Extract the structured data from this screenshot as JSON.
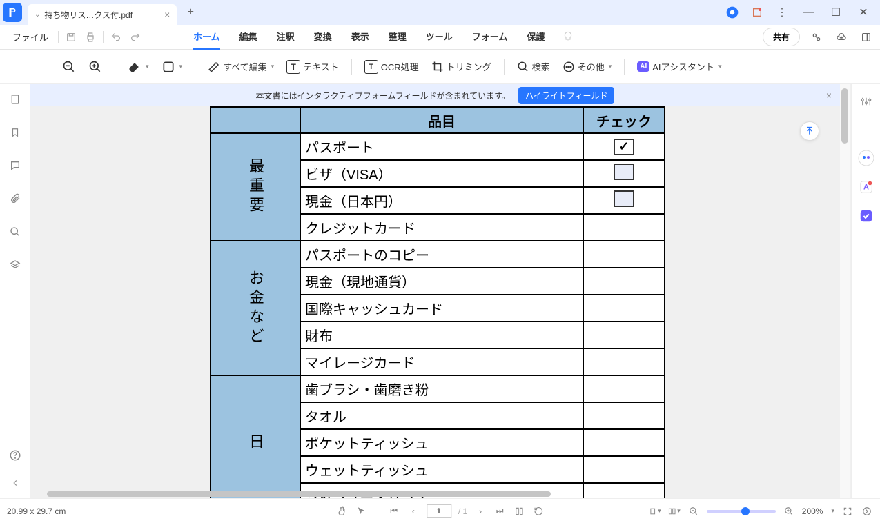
{
  "titlebar": {
    "tab_title": "持ち物リス…クス付.pdf"
  },
  "menubar": {
    "file": "ファイル",
    "tabs": [
      "ホーム",
      "編集",
      "注釈",
      "変換",
      "表示",
      "整理",
      "ツール",
      "フォーム",
      "保護"
    ],
    "share": "共有"
  },
  "toolbar": {
    "edit_all": "すべて編集",
    "text": "テキスト",
    "ocr": "OCR処理",
    "trimming": "トリミング",
    "search": "検索",
    "other": "その他",
    "ai_badge": "AI",
    "ai_assistant": "AIアシスタント"
  },
  "banner": {
    "text": "本文書にはインタラクティブフォームフィールドが含まれています。",
    "button": "ハイライトフィールド"
  },
  "table": {
    "header_item": "品目",
    "header_check": "チェック",
    "sections": [
      {
        "label": "最重要",
        "rows": [
          {
            "item": "パスポート",
            "checkbox": true,
            "checked": true
          },
          {
            "item": "ビザ（VISA）",
            "checkbox": true,
            "checked": false
          },
          {
            "item": "現金（日本円）",
            "checkbox": true,
            "checked": false
          },
          {
            "item": "クレジットカード",
            "checkbox": false
          }
        ]
      },
      {
        "label": "お金など",
        "rows": [
          {
            "item": "パスポートのコピー",
            "checkbox": false
          },
          {
            "item": "現金（現地通貨）",
            "checkbox": false
          },
          {
            "item": "国際キャッシュカード",
            "checkbox": false
          },
          {
            "item": "財布",
            "checkbox": false
          },
          {
            "item": "マイレージカード",
            "checkbox": false
          }
        ]
      },
      {
        "label": "日",
        "rows": [
          {
            "item": "歯ブラシ・歯磨き粉",
            "checkbox": false
          },
          {
            "item": "タオル",
            "checkbox": false
          },
          {
            "item": "ポケットティッシュ",
            "checkbox": false
          },
          {
            "item": "ウェットティッシュ",
            "checkbox": false
          },
          {
            "item": "シャンプー・リンス",
            "checkbox": false
          }
        ]
      }
    ]
  },
  "statusbar": {
    "dimensions": "20.99 x 29.7 cm",
    "page": "1",
    "page_total": "/ 1",
    "zoom": "200%"
  }
}
